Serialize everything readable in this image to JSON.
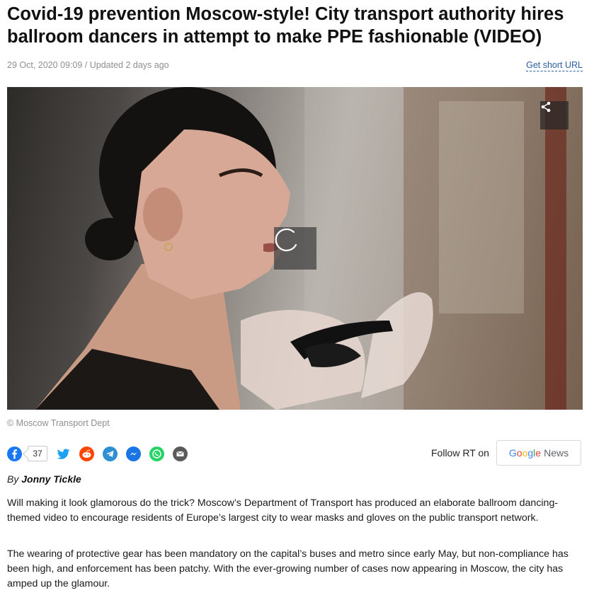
{
  "article": {
    "title": "Covid-19 prevention Moscow-style! City transport authority hires ballroom dancers in attempt to make PPE fashionable (VIDEO)",
    "meta": "29 Oct, 2020 09:09 / Updated 2 days ago",
    "short_url_label": "Get short URL",
    "image_credit": "© Moscow Transport Dept",
    "byline_prefix": "By",
    "author": "Jonny Tickle",
    "paragraphs": [
      "Will making it look glamorous do the trick? Moscow’s Department of Transport has produced an elaborate ballroom dancing-themed video to encourage residents of Europe’s largest city to wear masks and gloves on the public transport network.",
      "The wearing of protective gear has been mandatory on the capital’s buses and metro since early May, but non-compliance has been high, and enforcement has been patchy. With the ever-growing number of cases now appearing in Moscow, the city has amped up the glamour."
    ]
  },
  "media": {
    "share_icon": "share-icon",
    "loading_icon": "spinner-icon"
  },
  "social": {
    "facebook_count": "37",
    "icons": [
      {
        "name": "facebook-icon",
        "color": "#1877f2"
      },
      {
        "name": "twitter-icon",
        "color": "#1da1f2"
      },
      {
        "name": "reddit-icon",
        "color": "#ff4500"
      },
      {
        "name": "telegram-icon",
        "color": "#2f8fd0"
      },
      {
        "name": "messenger-icon",
        "color": "#1b74e4"
      },
      {
        "name": "whatsapp-icon",
        "color": "#25d366"
      },
      {
        "name": "email-icon",
        "color": "#5a5a5a"
      }
    ]
  },
  "follow": {
    "label": "Follow RT on",
    "google_letters": [
      "G",
      "o",
      "o",
      "g",
      "l",
      "e"
    ],
    "google_colors": [
      "#4285f4",
      "#ea4335",
      "#fbbc05",
      "#4285f4",
      "#34a853",
      "#ea4335"
    ],
    "news_label": "News"
  }
}
